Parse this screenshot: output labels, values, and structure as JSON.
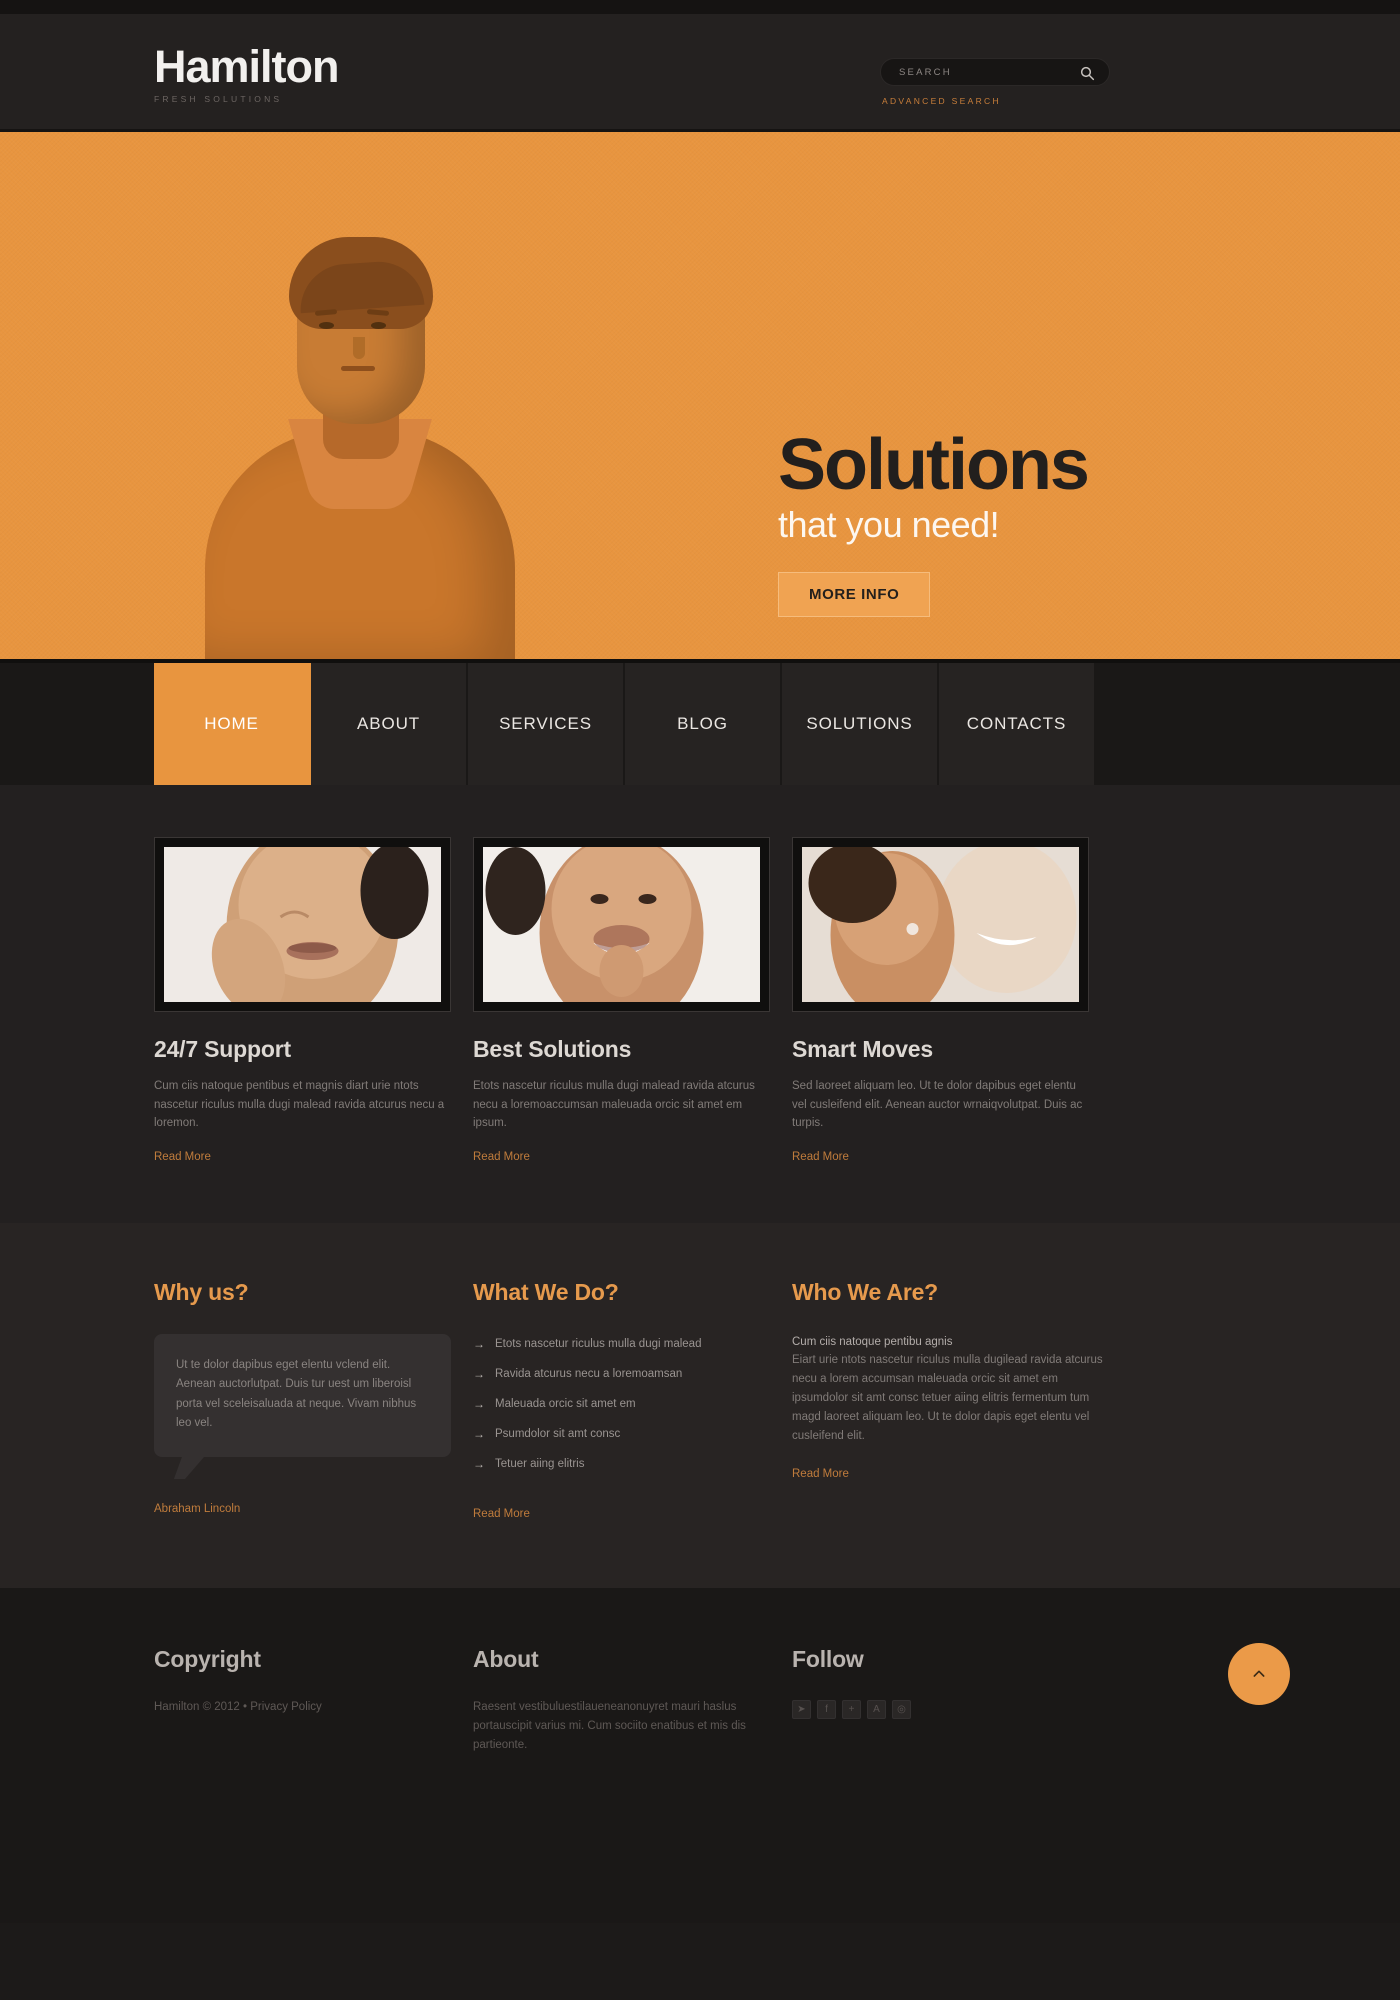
{
  "header": {
    "logo_title": "Hamilton",
    "logo_tagline": "FRESH SOLUTIONS",
    "search_placeholder": "SEARCH",
    "search_value": "",
    "search_icon": "search-icon",
    "advanced_search_label": "ADVANCED SEARCH"
  },
  "hero": {
    "heading": "Solutions",
    "subheading": "that you need!",
    "button_label": "MORE INFO",
    "slides": [
      "slide-1",
      "slide-2",
      "slide-3"
    ],
    "active_slide": 0,
    "bg_color": "#e8953f"
  },
  "nav": {
    "items": [
      {
        "label": "HOME",
        "active": true
      },
      {
        "label": "ABOUT",
        "active": false
      },
      {
        "label": "SERVICES",
        "active": false
      },
      {
        "label": "BLOG",
        "active": false
      },
      {
        "label": "SOLUTIONS",
        "active": false
      },
      {
        "label": "CONTACTS",
        "active": false
      }
    ],
    "active_color": "#e8953f"
  },
  "cards": [
    {
      "title": "24/7 Support",
      "text": "Cum ciis natoque pentibus et magnis diart urie ntots nascetur riculus mulla dugi malead ravida atcurus necu a loremon.",
      "more_label": "Read More",
      "image": "woman-hand-on-chin-photo"
    },
    {
      "title": "Best Solutions",
      "text": "Etots nascetur riculus mulla dugi malead ravida atcurus necu a loremoaccumsan maleuada orcic sit amet em ipsum.",
      "more_label": "Read More",
      "image": "smiling-woman-photo"
    },
    {
      "title": "Smart Moves",
      "text": "Sed laoreet aliquam leo. Ut te dolor dapibus eget elentu vel cusleifend elit. Aenean auctor wrnaiqvolutpat. Duis ac turpis.",
      "more_label": "Read More",
      "image": "woman-profile-photo"
    }
  ],
  "info": {
    "why": {
      "heading": "Why us?",
      "quote": "Ut te dolor dapibus eget elentu vclend elit. Aenean auctorlutpat. Duis tur uest um liberoisl porta vel sceleisaluada at neque. Vivam nibhus leo vel.",
      "author": "Abraham Lincoln"
    },
    "what": {
      "heading": "What We Do?",
      "items": [
        "Etots nascetur riculus mulla dugi malead",
        "Ravida atcurus necu a loremoamsan",
        "Maleuada orcic sit amet em",
        "Psumdolor sit amt consc",
        "Tetuer aiing elitris"
      ],
      "more_label": "Read More"
    },
    "who": {
      "heading": "Who We Are?",
      "lead": "Cum ciis natoque pentibu agnis",
      "text": "Eiart urie ntots nascetur riculus mulla dugilead ravida atcurus necu a lorem accumsan maleuada orcic sit amet em ipsumdolor sit amt consc tetuer aiing elitris fermentum tum magd laoreet aliquam leo. Ut te dolor dapis eget elentu vel cusleifend elit.",
      "more_label": "Read More"
    }
  },
  "footer": {
    "copyright": {
      "heading": "Copyright",
      "text": "Hamilton © 2012 • Privacy Policy"
    },
    "about": {
      "heading": "About",
      "text": "Raesent vestibuluestilaueneanonuyret mauri haslus portauscipit varius mi. Cum sociito enatibus et mis dis partieonte."
    },
    "follow": {
      "heading": "Follow",
      "socials": [
        {
          "name": "twitter-icon",
          "glyph": "➤"
        },
        {
          "name": "facebook-icon",
          "glyph": "f"
        },
        {
          "name": "google-plus-icon",
          "glyph": "+"
        },
        {
          "name": "behance-icon",
          "glyph": "A"
        },
        {
          "name": "rss-icon",
          "glyph": "◎"
        }
      ]
    },
    "to_top": {
      "name": "scroll-to-top-button",
      "glyph": "chevron-up-icon"
    }
  }
}
